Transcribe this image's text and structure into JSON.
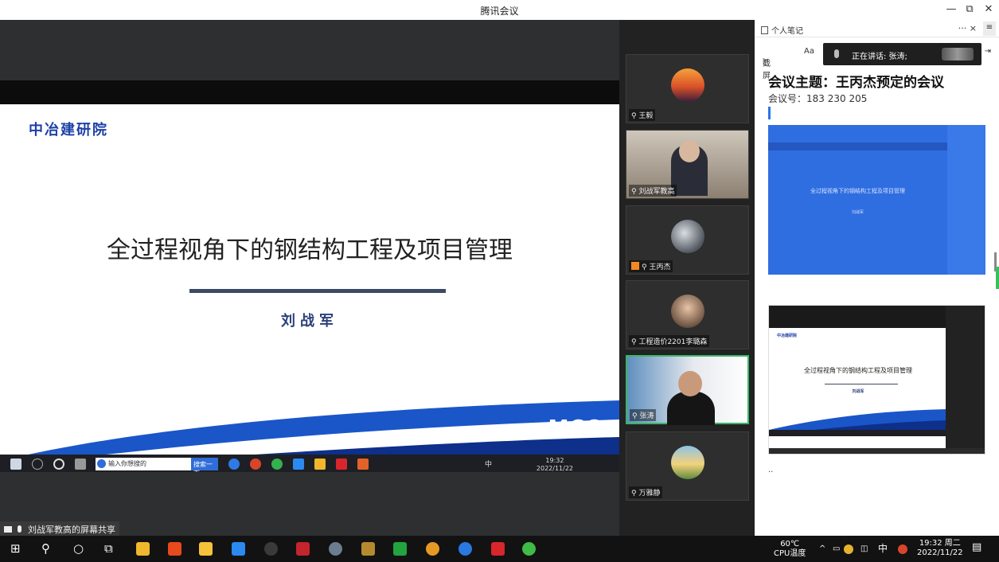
{
  "window": {
    "title": "腾讯会议",
    "minimize_icon": "—",
    "restore_icon": "⧉",
    "close_icon": "✕"
  },
  "slide": {
    "brand": "中冶建研院",
    "title": "全过程视角下的钢结构工程及项目管理",
    "author": "刘战军",
    "logo": "MCC",
    "colors": {
      "brand": "#1d3fa8",
      "swoosh": "#1a56c8"
    }
  },
  "inner_taskbar": {
    "search_placeholder": "输入你想搜的",
    "search_button": "搜索一下",
    "time": "19:32",
    "date": "2022/11/22",
    "ime": "中"
  },
  "share_label": "刘战军教高的屏幕共享",
  "participants": [
    {
      "name": "王毅",
      "avatar": "sunset-avatar",
      "active": false
    },
    {
      "name": "刘战军教高",
      "avatar": "camera-video",
      "active": false
    },
    {
      "name": "王丙杰",
      "avatar": "moon-avatar",
      "active": false,
      "host": true
    },
    {
      "name": "工程造价2201李璐森",
      "avatar": "person-avatar",
      "active": false
    },
    {
      "name": "张涛",
      "avatar": "camera-video",
      "active": true
    },
    {
      "name": "万雅静",
      "avatar": "landscape-avatar",
      "active": false
    }
  ],
  "notes": {
    "header": "个人笔记",
    "more": "···",
    "close": "×",
    "tools": {
      "screenshot": "截屏",
      "font": "Aa"
    },
    "speaking": "正在讲话: 张涛;",
    "meeting_title": "会议主题：王丙杰预定的会议",
    "meeting_id": "会议号：183 230 205",
    "thumb2": {
      "brand": "中冶建研院",
      "title": "全过程视角下的钢结构工程及项目管理",
      "author": "刘战军"
    },
    "thumb1": {
      "title": "全过程视角下的钢结构工程及项目管理",
      "author": "刘战军"
    },
    "ellipsis": ".."
  },
  "taskbar": {
    "temp": "60℃",
    "temp_label": "CPU温度",
    "ime": "中",
    "time": "19:32 周二",
    "date": "2022/11/22"
  }
}
